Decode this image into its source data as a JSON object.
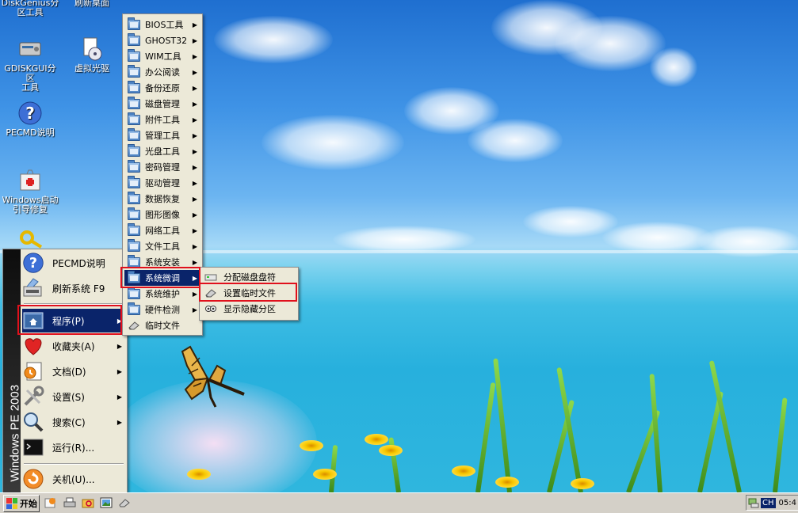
{
  "desktop": {
    "icons": [
      {
        "label": "DiskGenius分区工具",
        "label_lines": [
          "DiskGenius分",
          "区工具"
        ],
        "icon": "diskgenius-icon"
      },
      {
        "label": "刷新桌面",
        "icon": "refresh-desktop-icon"
      },
      {
        "label": "GDISKGUI分区工具",
        "label_lines": [
          "GDISKGUI分区",
          "工具"
        ],
        "icon": "gdiskgui-icon"
      },
      {
        "label": "虚拟光驱",
        "icon": "virtual-drive-icon"
      },
      {
        "label": "PECMD说明",
        "icon": "help-icon"
      },
      {
        "label": "Windows启动引导修复",
        "label_lines": [
          "Windows启动",
          "引导修复"
        ],
        "icon": "boot-repair-icon"
      }
    ]
  },
  "start_menu": {
    "band_text": "Windows PE 2003",
    "items": [
      {
        "label": "PECMD说明",
        "icon": "help-icon",
        "has_submenu": false
      },
      {
        "label": "刷新系统 F9",
        "icon": "refresh-system-icon",
        "has_submenu": false
      },
      {
        "label": "程序(P)",
        "icon": "programs-icon",
        "has_submenu": true,
        "active": true
      },
      {
        "label": "收藏夹(A)",
        "icon": "favorites-icon",
        "has_submenu": true
      },
      {
        "label": "文档(D)",
        "icon": "documents-icon",
        "has_submenu": true
      },
      {
        "label": "设置(S)",
        "icon": "settings-icon",
        "has_submenu": true
      },
      {
        "label": "搜索(C)",
        "icon": "search-icon",
        "has_submenu": true
      },
      {
        "label": "运行(R)...",
        "icon": "run-icon",
        "has_submenu": false
      },
      {
        "label": "关机(U)...",
        "icon": "shutdown-icon",
        "has_submenu": false
      }
    ]
  },
  "programs_menu": {
    "items": [
      {
        "label": "BIOS工具",
        "has_submenu": true
      },
      {
        "label": "GHOST32",
        "has_submenu": true
      },
      {
        "label": "WIM工具",
        "has_submenu": true
      },
      {
        "label": "办公阅读",
        "has_submenu": true
      },
      {
        "label": "备份还原",
        "has_submenu": true
      },
      {
        "label": "磁盘管理",
        "has_submenu": true
      },
      {
        "label": "附件工具",
        "has_submenu": true
      },
      {
        "label": "管理工具",
        "has_submenu": true
      },
      {
        "label": "光盘工具",
        "has_submenu": true
      },
      {
        "label": "密码管理",
        "has_submenu": true
      },
      {
        "label": "驱动管理",
        "has_submenu": true
      },
      {
        "label": "数据恢复",
        "has_submenu": true
      },
      {
        "label": "图形图像",
        "has_submenu": true
      },
      {
        "label": "网络工具",
        "has_submenu": true
      },
      {
        "label": "文件工具",
        "has_submenu": true
      },
      {
        "label": "系统安装",
        "has_submenu": true
      },
      {
        "label": "系统微调",
        "has_submenu": true,
        "active": true
      },
      {
        "label": "系统维护",
        "has_submenu": true
      },
      {
        "label": "硬件检测",
        "has_submenu": true
      },
      {
        "label": "临时文件",
        "has_submenu": false,
        "icon": "eraser-icon"
      }
    ]
  },
  "tweak_menu": {
    "items": [
      {
        "label": "分配磁盘盘符",
        "icon": "drive-icon"
      },
      {
        "label": "设置临时文件",
        "icon": "eraser-icon"
      },
      {
        "label": "显示隐藏分区",
        "icon": "eyes-icon"
      }
    ]
  },
  "taskbar": {
    "start_label": "开始",
    "quick_launch": [
      "restart-icon",
      "printer-icon",
      "folder-search-icon",
      "image-icon",
      "eraser-icon"
    ],
    "tray": {
      "lang": "CH",
      "clock": "05:4"
    }
  },
  "colors": {
    "highlight": "#0a246a",
    "annotation_box": "#e0101c",
    "menu_bg": "#ece9d8",
    "taskbar_bg": "#d4d0c8"
  }
}
